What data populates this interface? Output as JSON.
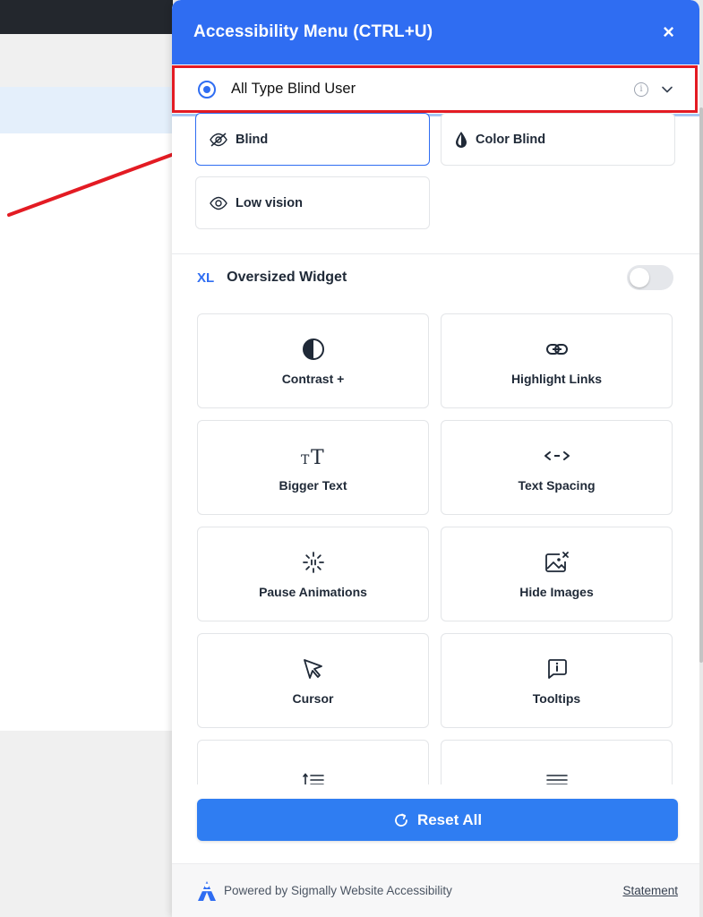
{
  "panel": {
    "title": "Accessibility Menu (CTRL+U)",
    "close_symbol": "×"
  },
  "profile": {
    "label": "All Type Blind User",
    "selected": true,
    "info_symbol": "i"
  },
  "vision_options": [
    {
      "label": "Blind",
      "icon": "eye-slash-icon",
      "active": true
    },
    {
      "label": "Color Blind",
      "icon": "drop-icon",
      "active": false
    },
    {
      "label": "Low vision",
      "icon": "eye-icon",
      "active": false
    }
  ],
  "oversized": {
    "badge": "XL",
    "label": "Oversized Widget",
    "enabled": false
  },
  "tools": [
    {
      "label": "Contrast +",
      "icon": "contrast-icon"
    },
    {
      "label": "Highlight Links",
      "icon": "link-icon"
    },
    {
      "label": "Bigger Text",
      "icon": "text-size-icon"
    },
    {
      "label": "Text Spacing",
      "icon": "text-spacing-icon"
    },
    {
      "label": "Pause Animations",
      "icon": "pause-animation-icon"
    },
    {
      "label": "Hide Images",
      "icon": "hide-image-icon"
    },
    {
      "label": "Cursor",
      "icon": "cursor-icon"
    },
    {
      "label": "Tooltips",
      "icon": "tooltip-icon"
    },
    {
      "label": "",
      "icon": "line-height-icon"
    },
    {
      "label": "",
      "icon": "text-align-icon"
    }
  ],
  "reset": {
    "label": "Reset All"
  },
  "footer": {
    "powered_by": "Powered by Sigmally Website Accessibility",
    "statement": "Statement"
  },
  "colors": {
    "accent": "#2f6df2",
    "highlight_border": "#e31b23",
    "reset_button": "#2f7df2"
  }
}
